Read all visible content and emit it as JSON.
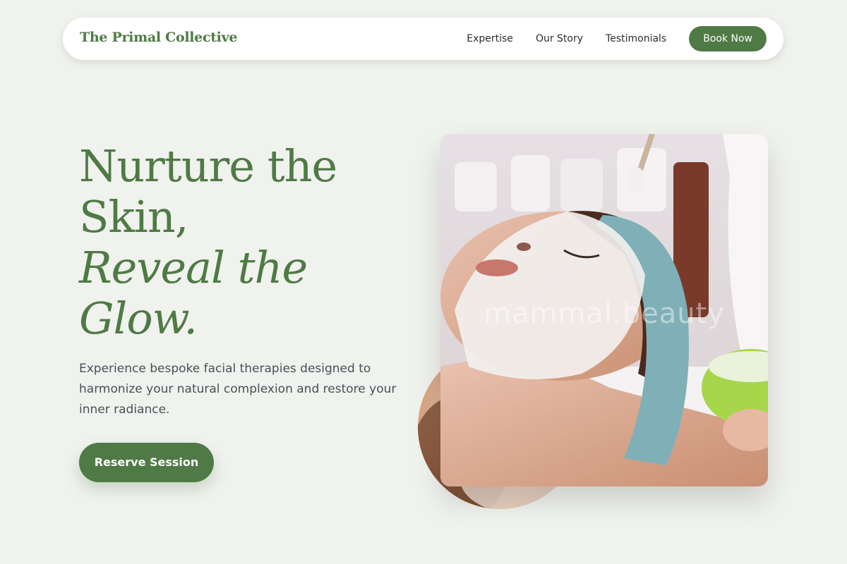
{
  "nav": {
    "brand": "The Primal Collective",
    "links": [
      "Expertise",
      "Our Story",
      "Testimonials"
    ],
    "cta": "Book Now"
  },
  "hero": {
    "title_line1": "Nurture the",
    "title_line2": "Skin,",
    "title_italic1": "Reveal the",
    "title_italic2": "Glow.",
    "description": "Experience bespoke facial therapies designed to harmonize your natural complexion and restore your inner radiance.",
    "cta": "Reserve Session"
  },
  "image": {
    "watermark": "mammal.beauty"
  },
  "colors": {
    "accent": "#4f7a45",
    "background": "#f0f2ee",
    "text": "#4a5057"
  }
}
